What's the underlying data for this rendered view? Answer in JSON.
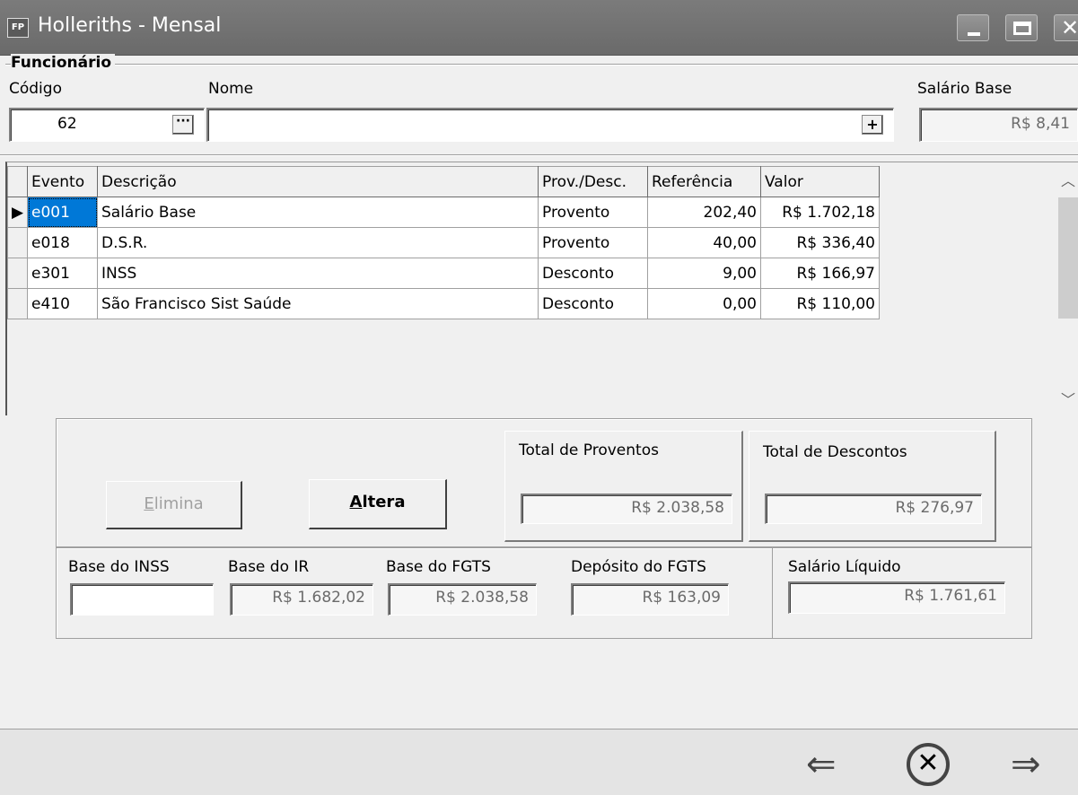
{
  "window": {
    "icon_text": "FP",
    "title": "Holleriths - Mensal"
  },
  "funcionario": {
    "group_label": "Funcionário",
    "codigo_label": "Código",
    "codigo_value": "62",
    "nome_label": "Nome",
    "nome_value": "",
    "salario_base_label": "Salário Base",
    "salario_base_value": "R$ 8,41"
  },
  "grid": {
    "columns": [
      "Evento",
      "Descrição",
      "Prov./Desc.",
      "Referência",
      "Valor"
    ],
    "rows": [
      {
        "evento": "e001",
        "descricao": "Salário Base",
        "prov_desc": "Provento",
        "referencia": "202,40",
        "valor": "R$ 1.702,18"
      },
      {
        "evento": "e018",
        "descricao": "D.S.R.",
        "prov_desc": "Provento",
        "referencia": "40,00",
        "valor": "R$ 336,40"
      },
      {
        "evento": "e301",
        "descricao": "INSS",
        "prov_desc": "Desconto",
        "referencia": "9,00",
        "valor": "R$ 166,97"
      },
      {
        "evento": "e410",
        "descricao": "São Francisco Sist Saúde",
        "prov_desc": "Desconto",
        "referencia": "0,00",
        "valor": "R$ 110,00"
      }
    ]
  },
  "actions": {
    "elimina_label": "Elimina",
    "elimina_underline": "E",
    "elimina_rest": "limina",
    "altera_underline": "A",
    "altera_rest": "ltera"
  },
  "totals": {
    "proventos_label": "Total de Proventos",
    "proventos_value": "R$ 2.038,58",
    "descontos_label": "Total de Descontos",
    "descontos_value": "R$ 276,97"
  },
  "bases": {
    "inss_label": "Base do INSS",
    "inss_value": "",
    "ir_label": "Base do IR",
    "ir_value": "R$ 1.682,02",
    "fgts_label": "Base do FGTS",
    "fgts_value": "R$ 2.038,58",
    "deposito_label": "Depósito do FGTS",
    "deposito_value": "R$ 163,09",
    "liquido_label": "Salário Líquido",
    "liquido_value": "R$ 1.761,61"
  },
  "nav": {
    "prev_icon": "arrow-left-icon",
    "cancel_icon": "cancel-circle-icon",
    "next_icon": "arrow-right-icon"
  }
}
